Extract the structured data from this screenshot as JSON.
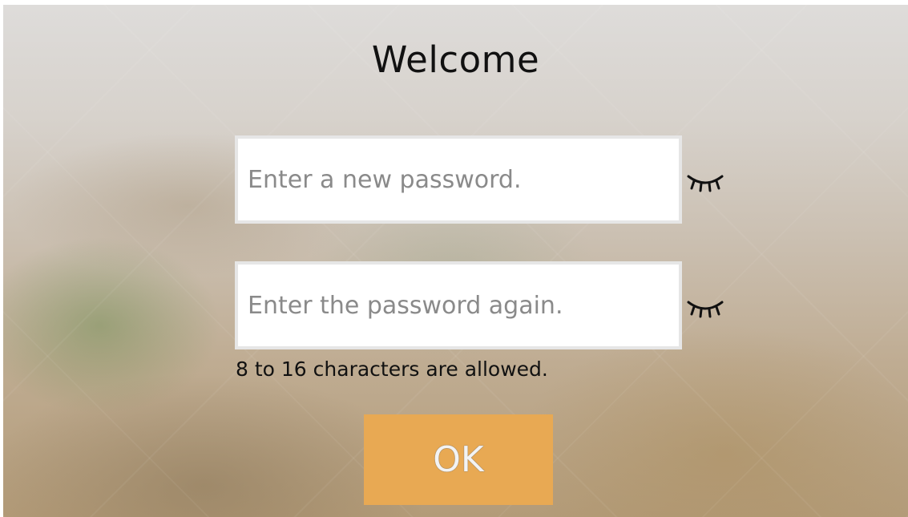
{
  "title": "Welcome",
  "new_password": {
    "placeholder": "Enter a new password.",
    "value": "",
    "toggle_icon": "eye-closed-icon"
  },
  "confirm_password": {
    "placeholder": "Enter the password again.",
    "value": "",
    "toggle_icon": "eye-closed-icon"
  },
  "hint": "8 to 16 characters are allowed.",
  "ok_label": "OK",
  "colors": {
    "ok_button": "#e8a953",
    "field_background": "#ffffff",
    "title_text": "#111111",
    "placeholder_text": "#8a8a8a"
  }
}
